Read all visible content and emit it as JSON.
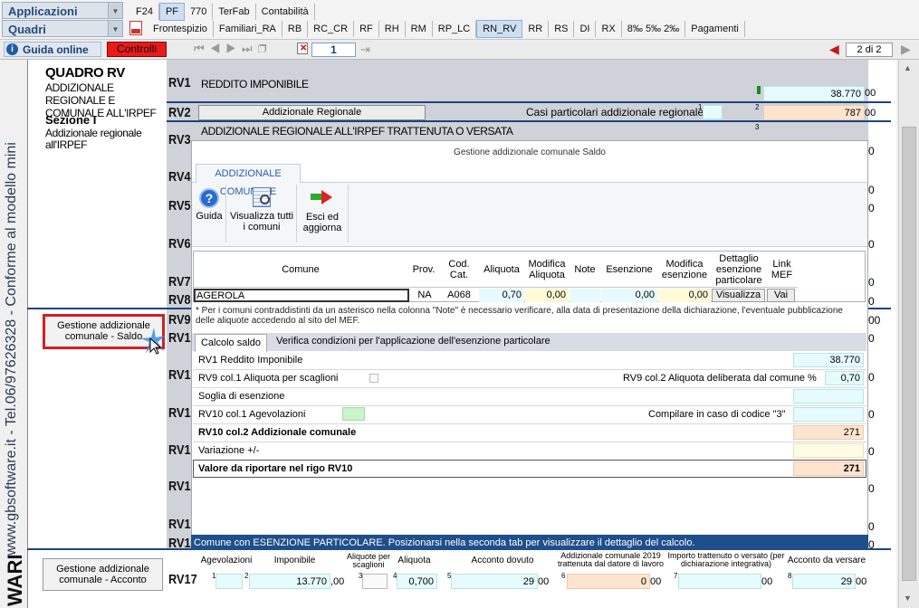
{
  "app": {
    "apps_menu": "Applicazioni",
    "quadri_menu": "Quadri",
    "top_tabs": [
      "F24",
      "PF",
      "770",
      "TerFab",
      "Contabilità"
    ],
    "quadri_tabs": [
      "Frontespizio",
      "Familiari_RA",
      "RB",
      "RC_CR",
      "RF",
      "RH",
      "RM",
      "RP_LC",
      "RN_RV",
      "RR",
      "RS",
      "DI",
      "RX",
      "8‰ 5‰ 2‰",
      "Pagamenti"
    ],
    "selected_top": "PF",
    "selected_quadro": "RN_RV"
  },
  "toolbar": {
    "guida_online": "Guida online",
    "controlli": "Controlli",
    "page_input": "1",
    "page_of": "2 di 2"
  },
  "sidebar": {
    "vertical_text": "www.gbsoftware.it - Tel.06/97626328 - Conforme al modello mini",
    "quadro_title": "QUADRO RV",
    "quadro_subtitle": "ADDIZIONALE REGIONALE E COMUNALE ALL'IRPEF",
    "sezione": "Sezione I",
    "sezione_desc": "Addizionale regionale all'IRPEF",
    "btn_saldo": "Gestione addizionale comunale - Saldo",
    "btn_acconto": "Gestione addizionale comunale - Acconto",
    "brand_partial": "WARE"
  },
  "form": {
    "rv_labels": [
      "RV1",
      "RV2",
      "RV3",
      "RV4",
      "RV5",
      "RV6",
      "RV7",
      "RV8",
      "RV9",
      "RV1",
      "RV1",
      "RV1",
      "RV1",
      "RV1",
      "RV1",
      "RV1",
      "RV17"
    ],
    "rv1_desc": "REDDITO IMPONIBILE",
    "rv1_value": "38.770",
    "rv1_cents": "00",
    "rv2_button": "Addizionale Regionale",
    "rv2_casi": "Casi particolari addizionale regionale",
    "rv2_idx1": "1",
    "rv2_idx2": "2",
    "rv2_value": "787",
    "rv2_cents": "00",
    "rv3_desc": "ADDIZIONALE REGIONALE ALL'IRPEF TRATTENUTA O VERSATA",
    "rv3_idx": "3",
    "right_zeros": [
      "0",
      "0",
      "0",
      "0",
      "0",
      "00",
      "0",
      "0",
      "0",
      "0",
      "0",
      "0",
      "0",
      "0",
      "0"
    ]
  },
  "dialog": {
    "title": "Gestione addizionale comunale Saldo",
    "ribbon_tab": "ADDIZIONALE COMUNALE",
    "tools": {
      "guida": "Guida",
      "visualizza": "Visualizza tutti i comuni",
      "esci": "Esci ed aggiorna"
    },
    "columns": [
      "Comune",
      "Prov.",
      "Cod. Cat.",
      "Aliquota",
      "Modifica Aliquota",
      "Note",
      "Esenzione",
      "Modifica esenzione",
      "Dettaglio esenzione particolare",
      "Link MEF"
    ],
    "row": {
      "comune": "AGEROLA",
      "prov": "NA",
      "cod": "A068",
      "aliquota": "0,70",
      "mod_aliquota": "0,00",
      "note": "",
      "esenzione": "0,00",
      "mod_esenzione": "0,00",
      "dettaglio": "Visualizza",
      "link": "Vai"
    },
    "note": "* Per i comuni contraddistinti da un asterisco nella colonna \"Note\" è necessario verificare,  alla data di presentazione della dichiarazione, l'eventuale pubblicazione delle aliquote accedendo al sito del MEF.",
    "subtabs": [
      "Calcolo saldo",
      "Verifica condizioni per l'applicazione dell'esenzione particolare"
    ],
    "calc": {
      "rv1_label": "RV1 Reddito Imponibile",
      "rv1_value": "38.770",
      "rv9c1_label": "RV9 col.1 Aliquota per scaglioni",
      "rv9c2_label": "RV9 col.2 Aliquota deliberata dal comune %",
      "rv9c2_value": "0,70",
      "soglia_label": "Soglia di esenzione",
      "rv10c1_label": "RV10 col.1 Agevolazioni",
      "codice3_label": "Compilare in caso di codice \"3\"",
      "rv10c2_label": "RV10 col.2 Addizionale comunale",
      "rv10c2_value": "271",
      "variazione_label": "Variazione +/-",
      "valore_label": "Valore da riportare nel rigo RV10",
      "valore_value": "271"
    },
    "status": "Comune con ESENZIONE PARTICOLARE. Posizionarsi nella seconda tab per visualizzare il dettaglio del calcolo."
  },
  "rv17": {
    "headers": [
      "Agevolazioni",
      "Imponibile",
      "Aliquote per scaglioni",
      "Aliquota",
      "Acconto dovuto",
      "Addizionale comunale 2019 trattenuta dal datore di lavoro",
      "Importo trattenuto o versato (per dichiarazione integrativa)",
      "Acconto da versare"
    ],
    "idx": [
      "1",
      "2",
      "3",
      "4",
      "5",
      "6",
      "7",
      "8"
    ],
    "imponibile": "13.770",
    "imponibile_cents": ",00",
    "aliquota": "0,700",
    "acconto_dovuto": "29",
    "acconto_dovuto_cents": "00",
    "trattenuta": "0",
    "trattenuta_cents": "00",
    "importo": "",
    "importo_cents": "00",
    "acconto_versare": "29",
    "acconto_versare_cents": "00"
  },
  "colors": {
    "accent": "#1e4f8c",
    "status_bar": "#1e4f8c",
    "highlight_red": "#d42020"
  }
}
